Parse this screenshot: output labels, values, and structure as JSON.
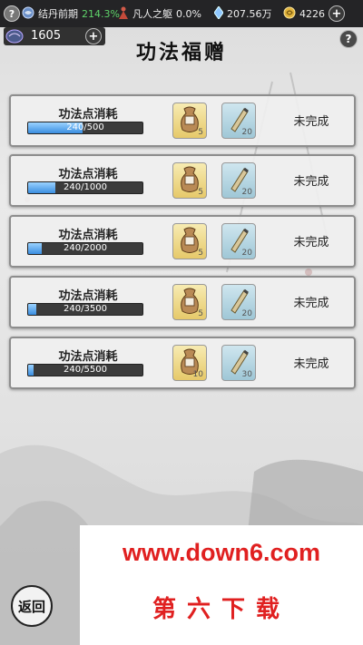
{
  "topbar": {
    "help_symbol": "?",
    "realm": "结丹前期",
    "realm_percent": "214.3%",
    "body_title": "凡人之躯",
    "body_percent": "0.0%",
    "spirit_stones": "207.56万",
    "gold": "4226",
    "add_symbol": "+"
  },
  "points": {
    "value": "1605",
    "add_symbol": "+"
  },
  "page_title": "功法福赠",
  "help_symbol": "?",
  "tasks": [
    {
      "label": "功法点消耗",
      "progress_text": "240/500",
      "progress": 0.48,
      "reward1_qty": "5",
      "reward2_qty": "20",
      "status": "未完成"
    },
    {
      "label": "功法点消耗",
      "progress_text": "240/1000",
      "progress": 0.24,
      "reward1_qty": "5",
      "reward2_qty": "20",
      "status": "未完成"
    },
    {
      "label": "功法点消耗",
      "progress_text": "240/2000",
      "progress": 0.12,
      "reward1_qty": "5",
      "reward2_qty": "20",
      "status": "未完成"
    },
    {
      "label": "功法点消耗",
      "progress_text": "240/3500",
      "progress": 0.069,
      "reward1_qty": "5",
      "reward2_qty": "20",
      "status": "未完成"
    },
    {
      "label": "功法点消耗",
      "progress_text": "240/5500",
      "progress": 0.044,
      "reward1_qty": "10",
      "reward2_qty": "30",
      "status": "未完成"
    }
  ],
  "back_label": "返回",
  "watermark": {
    "url": "www.down6.com",
    "name": "第六下载"
  },
  "colors": {
    "progress_fill": "#3a8ee0",
    "watermark": "#e02020",
    "realm_percent": "#5fd36a"
  }
}
